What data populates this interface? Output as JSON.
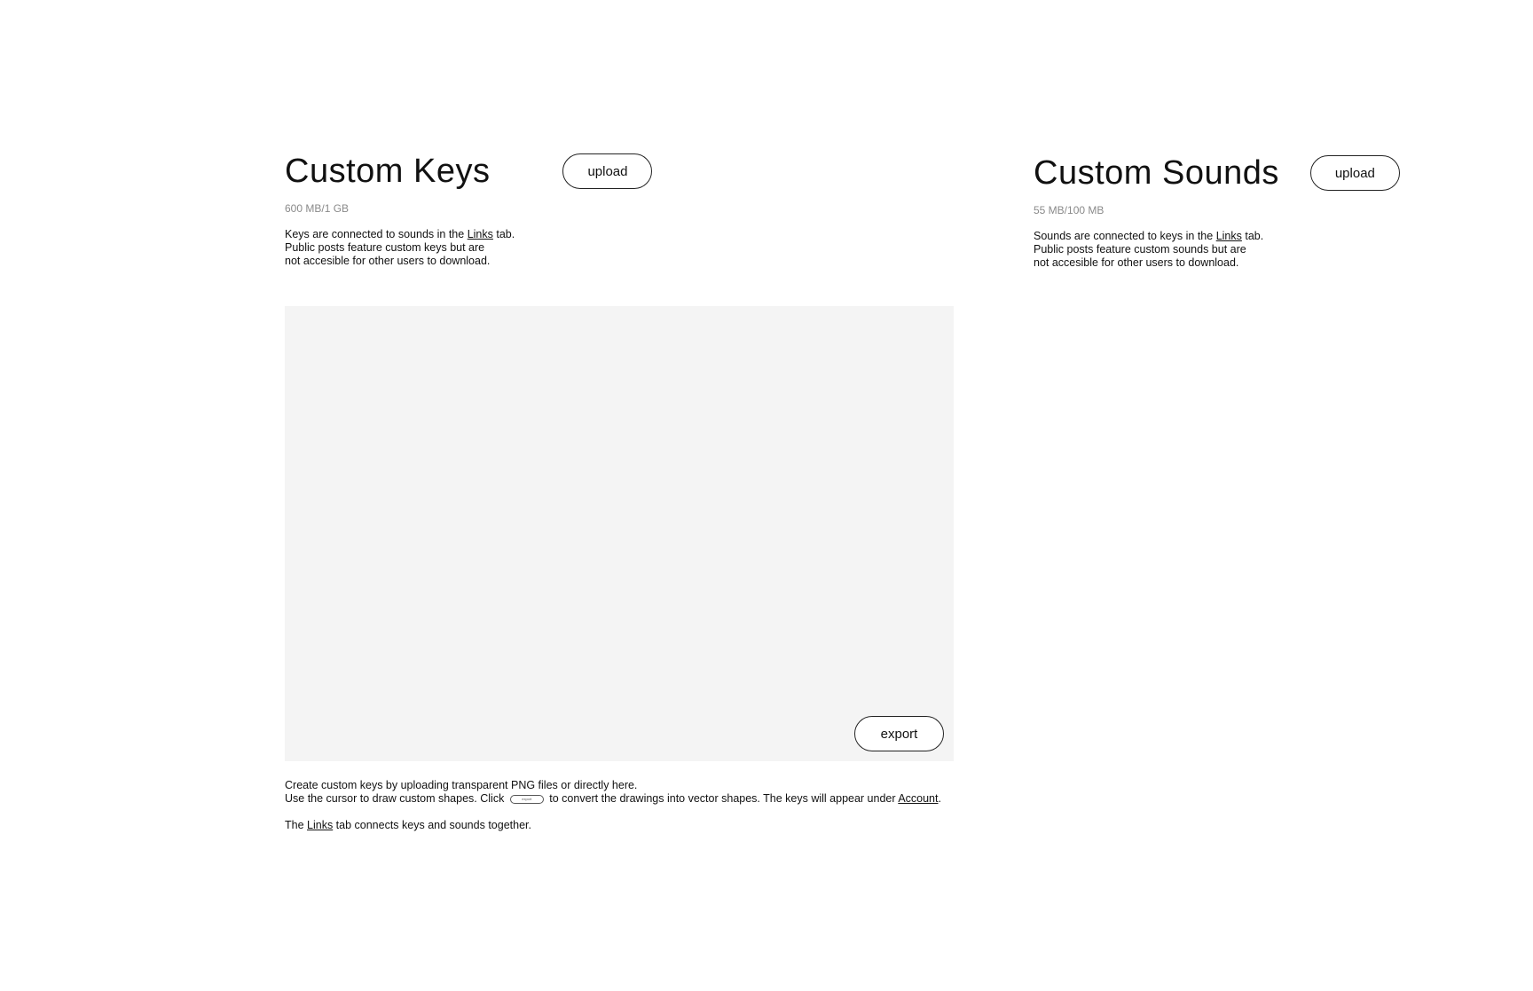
{
  "keys": {
    "title": "Custom Keys",
    "upload_label": "upload",
    "storage": "600 MB/1 GB",
    "desc_line1_pre": "Keys are connected to sounds in the ",
    "desc_line1_link": "Links",
    "desc_line1_post": " tab.",
    "desc_line2": "Public posts feature custom keys but are",
    "desc_line3": "not accesible for other users to download."
  },
  "sounds": {
    "title": "Custom Sounds",
    "upload_label": "upload",
    "storage": "55 MB/100 MB",
    "desc_line1_pre": "Sounds are connected to keys in the ",
    "desc_line1_link": "Links",
    "desc_line1_post": " tab.",
    "desc_line2": "Public posts feature custom sounds but are",
    "desc_line3": "not accesible for other users to download."
  },
  "canvas": {
    "export_label": "export"
  },
  "instructions": {
    "line1": "Create custom keys by uploading transparent PNG files or directly here.",
    "line2_pre": "Use the cursor to draw custom shapes. Click ",
    "line2_button": "export",
    "line2_mid": " to convert the drawings into vector shapes. The keys will appear under ",
    "line2_link": "Account",
    "line2_post": ".",
    "line3_pre": "The ",
    "line3_link": "Links",
    "line3_post": " tab connects keys and sounds together."
  }
}
